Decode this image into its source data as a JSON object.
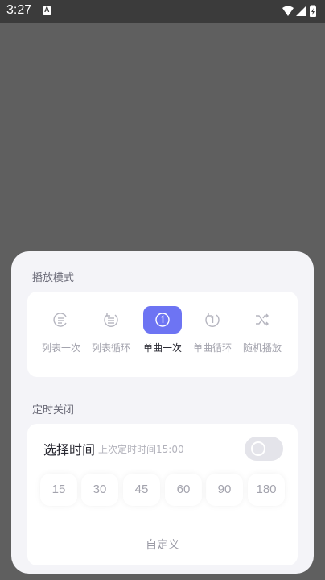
{
  "status_bar": {
    "time": "3:27",
    "icons": [
      "notification-a-icon",
      "wifi-icon",
      "signal-icon",
      "battery-charging-icon"
    ],
    "background": "#3b3b3b"
  },
  "sheet": {
    "play_mode": {
      "title": "播放模式",
      "modes": [
        {
          "label": "列表一次",
          "icon": "list-once-icon",
          "active": false
        },
        {
          "label": "列表循环",
          "icon": "list-loop-icon",
          "active": false
        },
        {
          "label": "单曲一次",
          "icon": "single-once-icon",
          "active": true
        },
        {
          "label": "单曲循环",
          "icon": "single-loop-icon",
          "active": false
        },
        {
          "label": "随机播放",
          "icon": "shuffle-icon",
          "active": false
        }
      ],
      "accent": "#6d74f3"
    },
    "timer": {
      "title": "定时关闭",
      "select_label": "选择时间",
      "last_time_hint": "上次定时时间15:00",
      "toggle_on": false,
      "minutes": [
        "15",
        "30",
        "45",
        "60",
        "90",
        "180"
      ],
      "custom_label": "自定义"
    }
  }
}
